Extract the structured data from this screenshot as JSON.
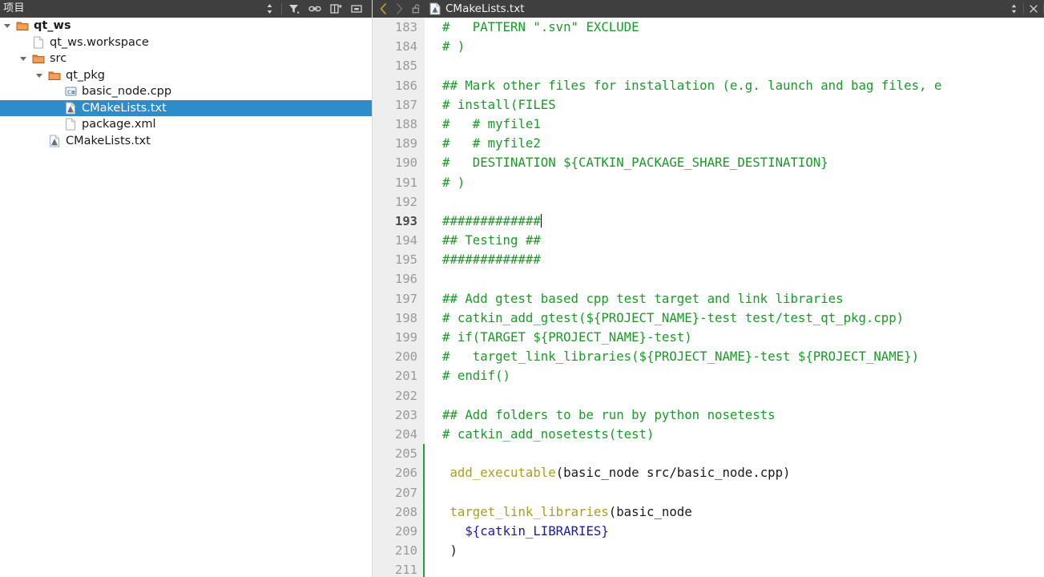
{
  "sidebar": {
    "title": "项目",
    "tools": [
      {
        "name": "sort-order-icon",
        "glyph": "sort"
      },
      {
        "name": "filter-icon",
        "glyph": "filter"
      },
      {
        "name": "link-sync-icon",
        "glyph": "link"
      },
      {
        "name": "add-split-icon",
        "glyph": "addsplit"
      },
      {
        "name": "collapse-panel-icon",
        "glyph": "minimize"
      }
    ],
    "tree": [
      {
        "label": "qt_ws",
        "depth": 0,
        "icon": "folder-icon",
        "twisty": "down",
        "bold": true,
        "selected": false
      },
      {
        "label": "qt_ws.workspace",
        "depth": 1,
        "icon": "file-icon",
        "twisty": "none",
        "bold": false,
        "selected": false
      },
      {
        "label": "src",
        "depth": 1,
        "icon": "folder-icon",
        "twisty": "down",
        "bold": false,
        "selected": false
      },
      {
        "label": "qt_pkg",
        "depth": 2,
        "icon": "folder-icon",
        "twisty": "down",
        "bold": false,
        "selected": false
      },
      {
        "label": "basic_node.cpp",
        "depth": 3,
        "icon": "cpp-file-icon",
        "twisty": "none",
        "bold": false,
        "selected": false
      },
      {
        "label": "CMakeLists.txt",
        "depth": 3,
        "icon": "cmake-file-icon",
        "twisty": "none",
        "bold": false,
        "selected": true
      },
      {
        "label": "package.xml",
        "depth": 3,
        "icon": "file-icon",
        "twisty": "none",
        "bold": false,
        "selected": false
      },
      {
        "label": "CMakeLists.txt",
        "depth": 2,
        "icon": "cmake-file-icon",
        "twisty": "none",
        "bold": false,
        "selected": false
      }
    ]
  },
  "editor": {
    "nav_back": "‹",
    "nav_forward": "›",
    "tab_title": "CMakeLists.txt",
    "lock_icon": "unlocked-padlock-icon",
    "file_icon": "cmake-file-icon",
    "split_icon": "split-view-icon",
    "close_icon": "close-icon",
    "first_visible_line": 183,
    "current_line": 193,
    "change_bar_color": "#22a33a",
    "change_bar_lines": [
      205,
      206,
      207,
      208,
      209,
      210,
      211
    ],
    "lines": [
      {
        "n": 183,
        "segments": [
          {
            "t": "#   PATTERN \".svn\" EXCLUDE",
            "c": "cm"
          }
        ]
      },
      {
        "n": 184,
        "segments": [
          {
            "t": "# )",
            "c": "cm"
          }
        ]
      },
      {
        "n": 185,
        "segments": []
      },
      {
        "n": 186,
        "segments": [
          {
            "t": "## Mark other files for installation (e.g. launch and bag files, e",
            "c": "cm"
          }
        ]
      },
      {
        "n": 187,
        "segments": [
          {
            "t": "# install(FILES",
            "c": "cm"
          }
        ]
      },
      {
        "n": 188,
        "segments": [
          {
            "t": "#   # myfile1",
            "c": "cm"
          }
        ]
      },
      {
        "n": 189,
        "segments": [
          {
            "t": "#   # myfile2",
            "c": "cm"
          }
        ]
      },
      {
        "n": 190,
        "segments": [
          {
            "t": "#   DESTINATION ${CATKIN_PACKAGE_SHARE_DESTINATION}",
            "c": "cm"
          }
        ]
      },
      {
        "n": 191,
        "segments": [
          {
            "t": "# )",
            "c": "cm"
          }
        ]
      },
      {
        "n": 192,
        "segments": []
      },
      {
        "n": 193,
        "segments": [
          {
            "t": "#############",
            "c": "cm"
          }
        ],
        "caret": true
      },
      {
        "n": 194,
        "segments": [
          {
            "t": "## Testing ##",
            "c": "cm"
          }
        ]
      },
      {
        "n": 195,
        "segments": [
          {
            "t": "#############",
            "c": "cm"
          }
        ]
      },
      {
        "n": 196,
        "segments": []
      },
      {
        "n": 197,
        "segments": [
          {
            "t": "## Add gtest based cpp test target and link libraries",
            "c": "cm"
          }
        ]
      },
      {
        "n": 198,
        "segments": [
          {
            "t": "# catkin_add_gtest(${PROJECT_NAME}-test test/test_qt_pkg.cpp)",
            "c": "cm"
          }
        ]
      },
      {
        "n": 199,
        "segments": [
          {
            "t": "# if(TARGET ${PROJECT_NAME}-test)",
            "c": "cm"
          }
        ]
      },
      {
        "n": 200,
        "segments": [
          {
            "t": "#   target_link_libraries(${PROJECT_NAME}-test ${PROJECT_NAME})",
            "c": "cm"
          }
        ]
      },
      {
        "n": 201,
        "segments": [
          {
            "t": "# endif()",
            "c": "cm"
          }
        ]
      },
      {
        "n": 202,
        "segments": []
      },
      {
        "n": 203,
        "segments": [
          {
            "t": "## Add folders to be run by python nosetests",
            "c": "cm"
          }
        ]
      },
      {
        "n": 204,
        "segments": [
          {
            "t": "# catkin_add_nosetests(test)",
            "c": "cm"
          }
        ]
      },
      {
        "n": 205,
        "segments": []
      },
      {
        "n": 206,
        "segments": [
          {
            "t": " ",
            "c": "pl"
          },
          {
            "t": "add_executable",
            "c": "fn"
          },
          {
            "t": "(basic_node src/basic_node.cpp)",
            "c": "pl"
          }
        ]
      },
      {
        "n": 207,
        "segments": []
      },
      {
        "n": 208,
        "segments": [
          {
            "t": " ",
            "c": "pl"
          },
          {
            "t": "target_link_libraries",
            "c": "fn"
          },
          {
            "t": "(basic_node",
            "c": "pl"
          }
        ]
      },
      {
        "n": 209,
        "segments": [
          {
            "t": "   ",
            "c": "pl"
          },
          {
            "t": "${catkin_LIBRARIES}",
            "c": "var"
          }
        ]
      },
      {
        "n": 210,
        "segments": [
          {
            "t": " )",
            "c": "pl"
          }
        ]
      },
      {
        "n": 211,
        "segments": []
      }
    ]
  },
  "colors": {
    "chrome": "#3f3f3f",
    "selection": "#2f8cca",
    "comment": "#1a9b28",
    "function": "#a6a020",
    "variable": "#1c1c9e",
    "gutter_bg": "#eeeeee",
    "gutter_fg": "#9a9a9a"
  }
}
